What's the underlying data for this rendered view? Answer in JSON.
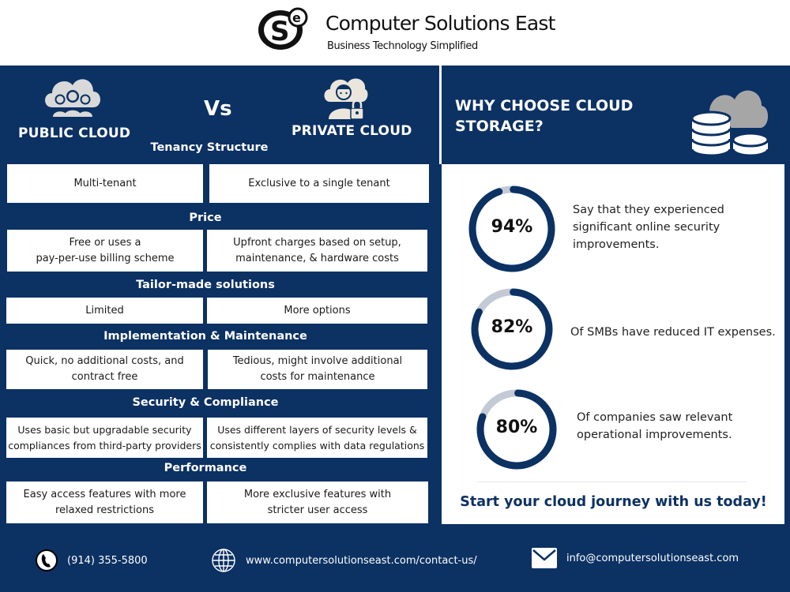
{
  "header": {
    "logo_icon": "cse-logo-icon",
    "brand_name": "Computer Solutions East",
    "tagline": "Business Technology Simplified"
  },
  "comparison": {
    "left_title": "PUBLIC CLOUD",
    "left_icon": "cloud-users-icon",
    "vs_label": "Vs",
    "right_title": "PRIVATE CLOUD",
    "right_icon": "cloud-user-lock-icon",
    "rows": [
      {
        "label": "Tenancy Structure",
        "public": "Multi-tenant",
        "private": "Exclusive to a single tenant"
      },
      {
        "label": "Price",
        "public": "Free or uses a\npay-per-use billing scheme",
        "private": "Upfront charges based on setup,\nmaintenance, & hardware costs"
      },
      {
        "label": "Tailor-made solutions",
        "public": "Limited",
        "private": "More options"
      },
      {
        "label": "Implementation & Maintenance",
        "public": "Quick, no additional costs, and\ncontract free",
        "private": "Tedious, might involve additional\ncosts for maintenance"
      },
      {
        "label": "Security & Compliance",
        "public": "Uses basic but upgradable security\ncompliances from third-party providers",
        "private": "Uses different layers of security levels &\nconsistently complies with data regulations"
      },
      {
        "label": "Performance",
        "public": "Easy access features with more\nrelaxed restrictions",
        "private": "More exclusive features with\nstricter user access"
      }
    ]
  },
  "why": {
    "title": "WHY CHOOSE CLOUD STORAGE?",
    "icon": "cloud-storage-database-icon",
    "stats": [
      {
        "value": "94%",
        "percent": 94,
        "text": "Say that they experienced significant online security improvements."
      },
      {
        "value": "82%",
        "percent": 82,
        "text": "Of SMBs have reduced IT expenses."
      },
      {
        "value": "80%",
        "percent": 80,
        "text": "Of companies saw relevant operational improvements."
      }
    ],
    "cta": "Start your cloud journey with us today!"
  },
  "footer": {
    "phone": "(914) 355-5800",
    "phone_icon": "phone-icon",
    "website": "www.computersolutionseast.com/contact-us/",
    "website_icon": "globe-icon",
    "email": "info@computersolutionseast.com",
    "email_icon": "envelope-icon"
  },
  "colors": {
    "navy": "#0c3163",
    "ring_track": "#c3cad6",
    "icon_gray": "#d9d9d9"
  }
}
